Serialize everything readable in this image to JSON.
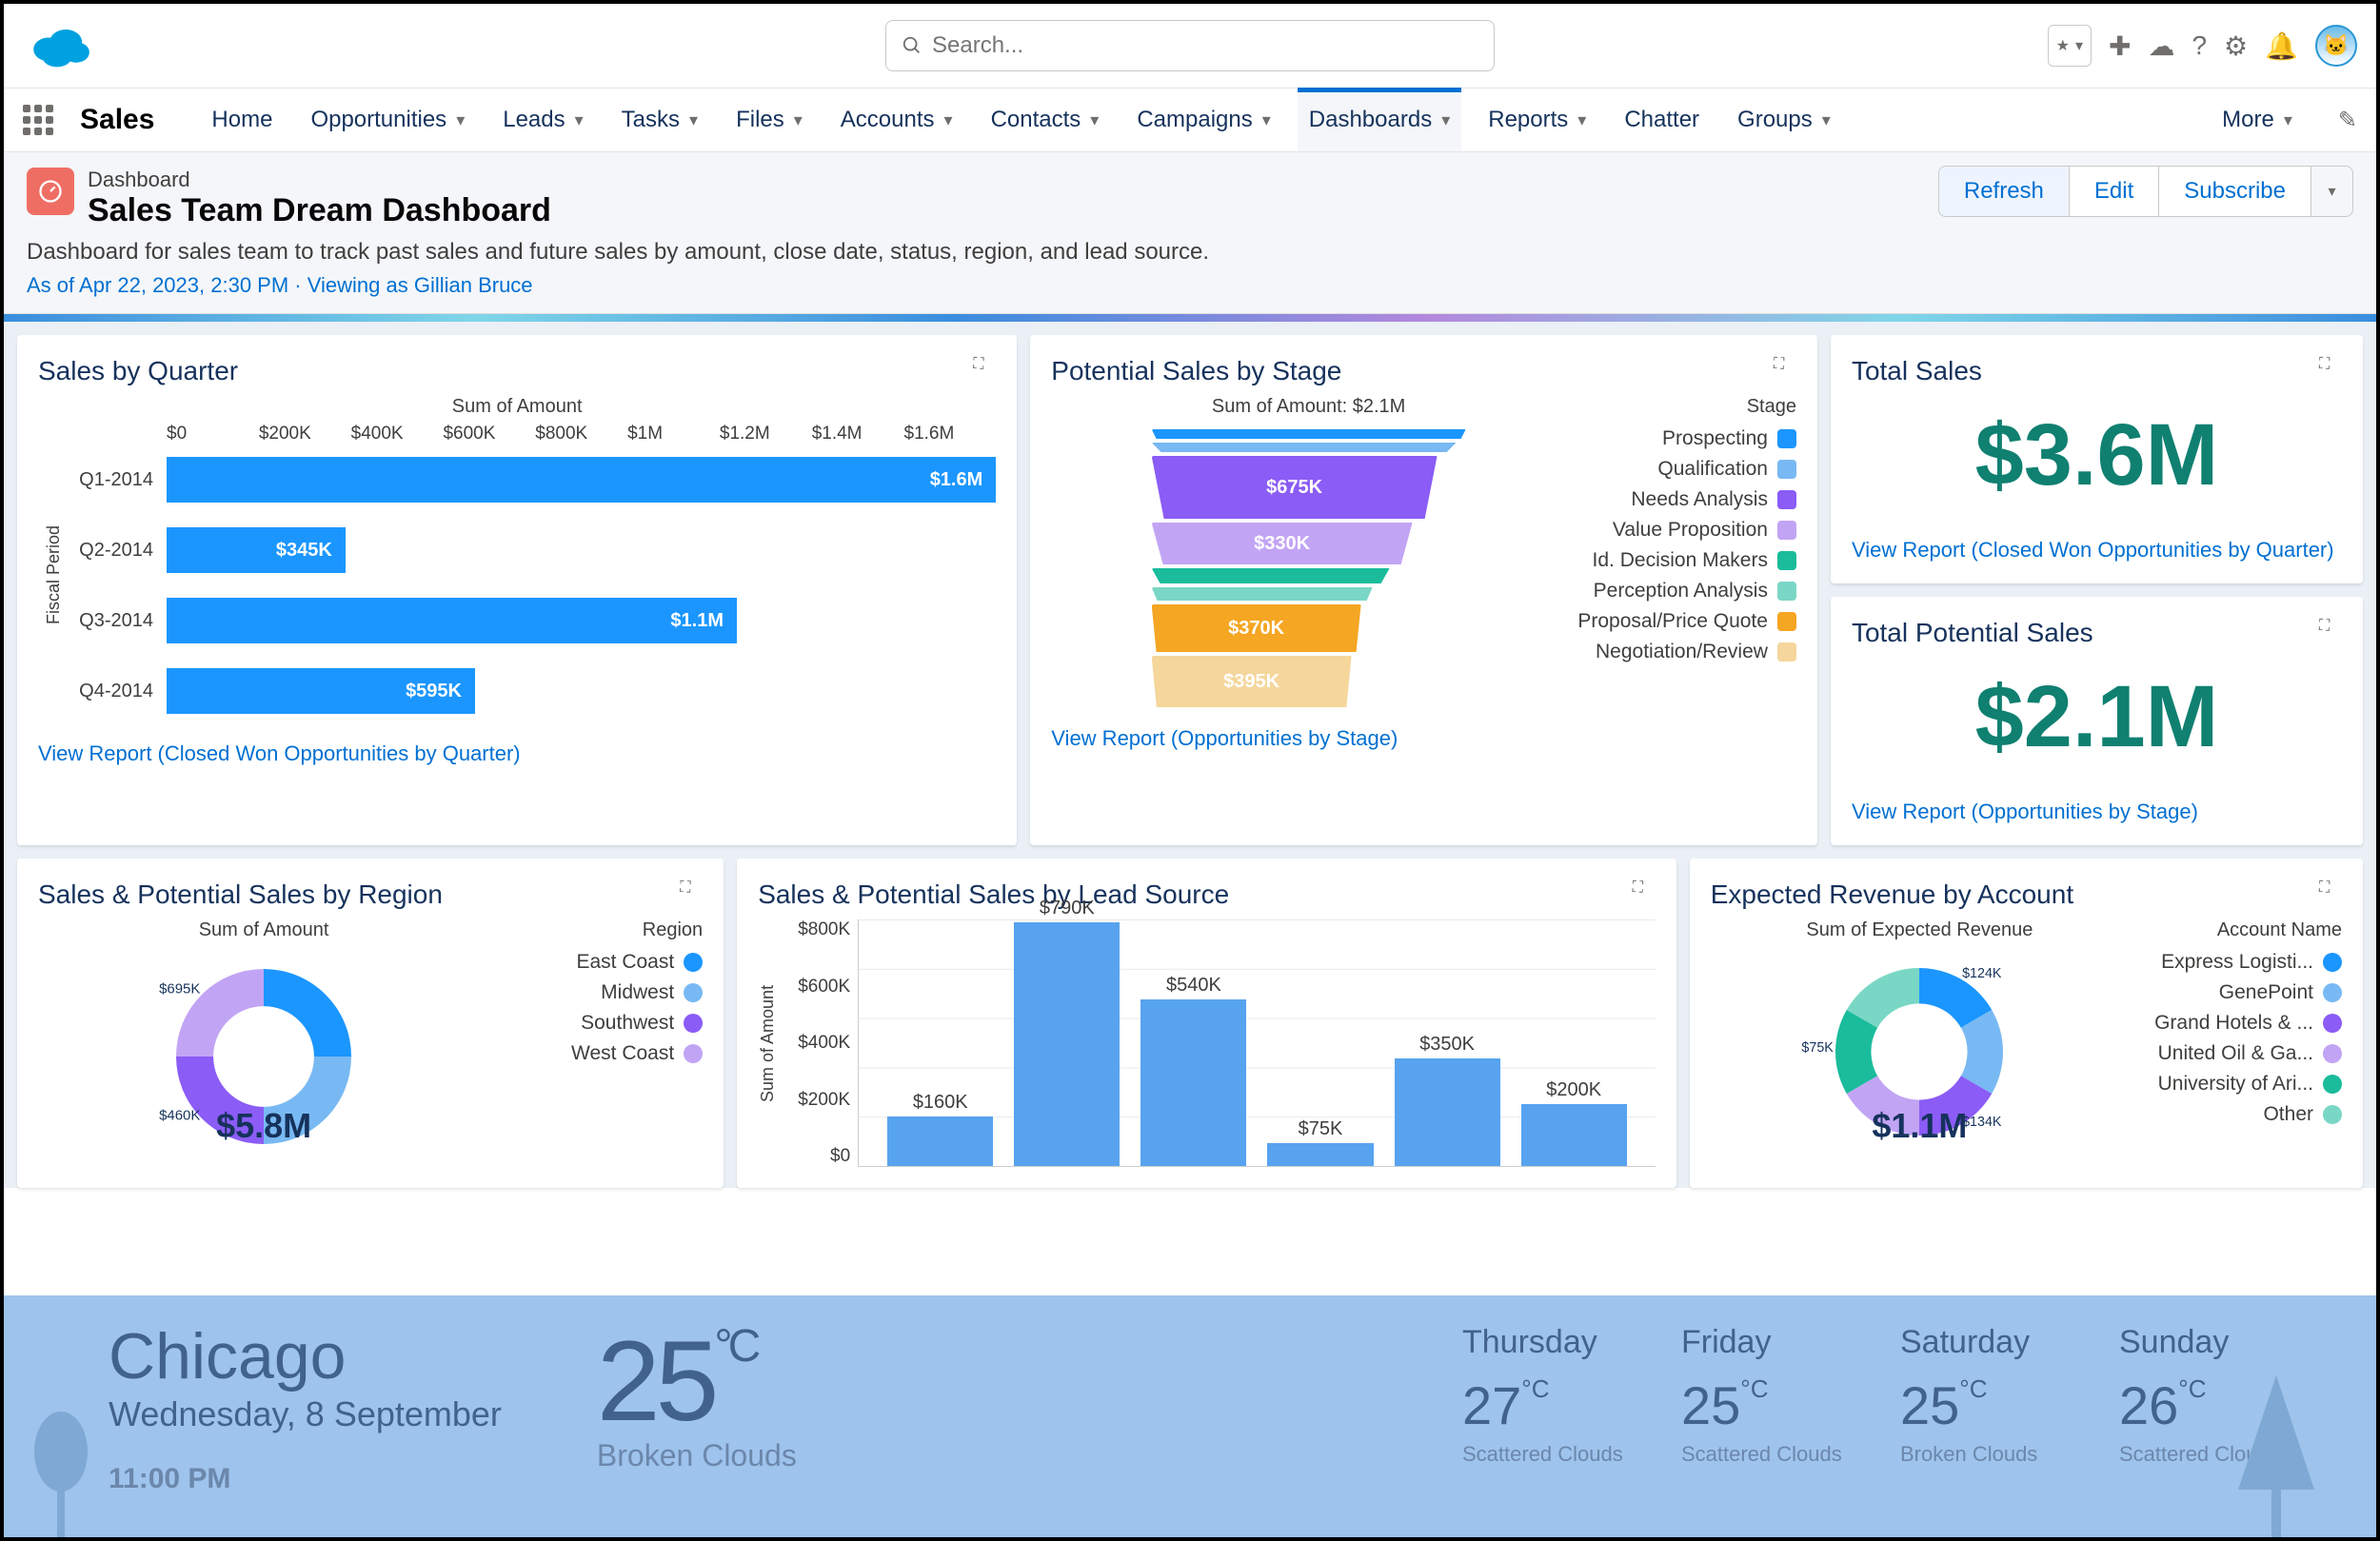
{
  "header": {
    "search_placeholder": "Search..."
  },
  "nav": {
    "app": "Sales",
    "items": [
      "Home",
      "Opportunities",
      "Leads",
      "Tasks",
      "Files",
      "Accounts",
      "Contacts",
      "Campaigns",
      "Dashboards",
      "Reports",
      "Chatter",
      "Groups"
    ],
    "more": "More"
  },
  "pagehead": {
    "label": "Dashboard",
    "title": "Sales Team Dream Dashboard",
    "desc": "Dashboard for sales team to track past sales and future sales by amount, close date, status, region, and lead source.",
    "meta": "As of Apr 22, 2023, 2:30 PM · Viewing as Gillian Bruce",
    "actions": {
      "refresh": "Refresh",
      "edit": "Edit",
      "subscribe": "Subscribe"
    }
  },
  "cards": {
    "sbq": {
      "title": "Sales by Quarter",
      "axis_title": "Sum of Amount",
      "ylabel": "Fiscal Period",
      "link": "View Report (Closed Won Opportunities by Quarter)",
      "ticks": [
        "$0",
        "$200K",
        "$400K",
        "$600K",
        "$800K",
        "$1M",
        "$1.2M",
        "$1.4M",
        "$1.6M"
      ]
    },
    "funnel": {
      "title": "Potential Sales by Stage",
      "subtitle": "Sum of Amount: $2.1M",
      "legend_title": "Stage",
      "link": "View Report (Opportunities by Stage)"
    },
    "ts": {
      "title": "Total Sales",
      "value": "$3.6M",
      "link": "View Report (Closed Won Opportunities by Quarter)"
    },
    "tps": {
      "title": "Total Potential Sales",
      "value": "$2.1M",
      "link": "View Report (Opportunities by Stage)"
    },
    "region": {
      "title": "Sales & Potential Sales by Region",
      "subtitle": "Sum of Amount",
      "legend_title": "Region",
      "center": "$5.8M"
    },
    "lead": {
      "title": "Sales & Potential Sales by Lead Source",
      "ylabel": "Sum of Amount",
      "ticks": [
        "$800K",
        "$600K",
        "$400K",
        "$200K",
        "$0"
      ]
    },
    "rev": {
      "title": "Expected Revenue by Account",
      "subtitle": "Sum of Expected Revenue",
      "legend_title": "Account Name",
      "center": "$1.1M"
    }
  },
  "chart_data": {
    "sales_by_quarter": {
      "type": "bar",
      "orientation": "horizontal",
      "ylabel": "Fiscal Period",
      "xlabel": "Sum of Amount",
      "xlim": [
        0,
        1600000
      ],
      "categories": [
        "Q1-2014",
        "Q2-2014",
        "Q3-2014",
        "Q4-2014"
      ],
      "values": [
        1600000,
        345000,
        1100000,
        595000
      ],
      "value_labels": [
        "$1.6M",
        "$345K",
        "$1.1M",
        "$595K"
      ]
    },
    "potential_sales_by_stage": {
      "type": "funnel",
      "total_label": "Sum of Amount: $2.1M",
      "series": [
        {
          "name": "Prospecting",
          "color": "#1b96ff"
        },
        {
          "name": "Qualification",
          "color": "#78b9f3"
        },
        {
          "name": "Needs Analysis",
          "value": 675000,
          "label": "$675K",
          "color": "#8b5cf6"
        },
        {
          "name": "Value Proposition",
          "value": 330000,
          "label": "$330K",
          "color": "#c2a4f5"
        },
        {
          "name": "Id. Decision Makers",
          "color": "#1abc9c"
        },
        {
          "name": "Perception Analysis",
          "color": "#7ad7c5"
        },
        {
          "name": "Proposal/Price Quote",
          "value": 370000,
          "label": "$370K",
          "color": "#f5a623"
        },
        {
          "name": "Negotiation/Review",
          "value": 395000,
          "label": "$395K",
          "color": "#f5d69b"
        }
      ]
    },
    "total_sales": {
      "type": "metric",
      "value": 3600000,
      "label": "$3.6M"
    },
    "total_potential_sales": {
      "type": "metric",
      "value": 2100000,
      "label": "$2.1M"
    },
    "sales_by_region": {
      "type": "donut",
      "title": "Sum of Amount",
      "total_label": "$5.8M",
      "series": [
        {
          "name": "East Coast",
          "color": "#1b96ff"
        },
        {
          "name": "Midwest",
          "color": "#78b9f3"
        },
        {
          "name": "Southwest",
          "value": 460000,
          "label": "$460K",
          "color": "#8b5cf6"
        },
        {
          "name": "West Coast",
          "value": 695000,
          "label": "$695K",
          "color": "#c2a4f5"
        }
      ]
    },
    "sales_by_lead_source": {
      "type": "bar",
      "ylabel": "Sum of Amount",
      "ylim": [
        0,
        800000
      ],
      "values": [
        160000,
        790000,
        540000,
        75000,
        350000,
        200000
      ],
      "value_labels": [
        "$160K",
        "$790K",
        "$540K",
        "$75K",
        "$350K",
        "$200K"
      ]
    },
    "expected_revenue_by_account": {
      "type": "donut",
      "title": "Sum of Expected Revenue",
      "total_label": "$1.1M",
      "series": [
        {
          "name": "Express Logisti...",
          "value": 124000,
          "label": "$124K",
          "color": "#1b96ff"
        },
        {
          "name": "GenePoint",
          "color": "#78b9f3"
        },
        {
          "name": "Grand Hotels & ...",
          "value": 134000,
          "label": "$134K",
          "color": "#8b5cf6"
        },
        {
          "name": "United Oil & Ga...",
          "color": "#c2a4f5"
        },
        {
          "name": "University of Ari...",
          "value": 75000,
          "label": "$75K",
          "color": "#1abc9c"
        },
        {
          "name": "Other",
          "color": "#7ad7c5"
        }
      ]
    }
  },
  "weather": {
    "city": "Chicago",
    "date": "Wednesday, 8 September",
    "time": "11:00 PM",
    "temp": "25",
    "unit": "°C",
    "cond": "Broken Clouds",
    "days": [
      {
        "name": "Thursday",
        "temp": "27",
        "cond": "Scattered Clouds"
      },
      {
        "name": "Friday",
        "temp": "25",
        "cond": "Scattered Clouds"
      },
      {
        "name": "Saturday",
        "temp": "25",
        "cond": "Broken Clouds"
      },
      {
        "name": "Sunday",
        "temp": "26",
        "cond": "Scattered Clouds"
      }
    ]
  }
}
